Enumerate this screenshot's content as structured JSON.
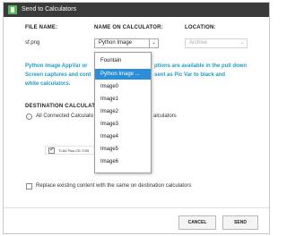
{
  "window": {
    "title": "Send to Calculators"
  },
  "headers": {
    "file_name": "FILE NAME:",
    "name_on_calculator": "NAME ON CALCULATOR:",
    "location": "LOCATION:"
  },
  "file": {
    "name": "sf.png",
    "calc_name_selected": "Python Image",
    "location_selected": "Archive"
  },
  "info_lines": [
    "Python image AppVar or",
    "Screen captures and cont",
    "white calculators."
  ],
  "info_right_lines": [
    "ptions are available in the pull down",
    "sent as Pic Var to black and"
  ],
  "destination": {
    "heading": "DESTINATION CALCULATO",
    "all_connected_label": "All Connected Calculato",
    "right_label": "alculators",
    "calculator_name": "TI-84 Plus CE-T/05"
  },
  "dropdown": {
    "options": [
      "Fountain",
      "Python Image ...",
      "Image0",
      "Image1",
      "Image2",
      "Image3",
      "Image4",
      "Image5",
      "Image6"
    ],
    "selected_index": 1
  },
  "replace_label": "Replace existing content with the same on destination calculators",
  "buttons": {
    "cancel": "CANCEL",
    "send": "SEND"
  },
  "colors": {
    "accent": "#2a8fd6",
    "info_text": "#1f9bc9",
    "titlebar": "#3a3a3a",
    "app_icon": "#5cb85c"
  }
}
